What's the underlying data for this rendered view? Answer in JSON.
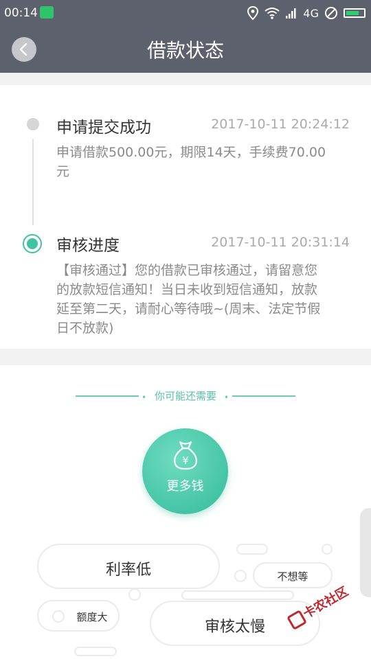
{
  "status_bar": {
    "time": "00:14",
    "network": "4G"
  },
  "header": {
    "title": "借款状态"
  },
  "timeline": [
    {
      "title": "申请提交成功",
      "time": "2017-10-11 20:24:12",
      "desc_line1": "申请借款500.00元，期限14天，手续费70.00",
      "desc_line2": "元"
    },
    {
      "title": "审核进度",
      "time": "2017-10-11 20:31:14",
      "desc_line1": "【审核通过】您的借款已审核通过，请留意您",
      "desc_line2": "的放款短信通知！当日未收到短信通知，放款",
      "desc_line3": "延至第二天，请耐心等待哦~(周末、法定节假",
      "desc_line4": "日不放款)"
    }
  ],
  "need": {
    "label": "你可能还需要",
    "more_money": "更多钱"
  },
  "tags": {
    "low_rate": "利率低",
    "no_wait": "不想等",
    "big_amount": "额度大",
    "slow_review": "审核太慢"
  },
  "watermark": "卡农社区",
  "colors": {
    "header_bg": "#5d606d",
    "accent": "#3ec4a2",
    "watermark": "#c0282d"
  },
  "icons": [
    "wechat-icon",
    "location-icon",
    "wifi-icon",
    "signal-icon",
    "no-sim-icon",
    "battery-icon",
    "back-arrow-icon",
    "money-bag-icon"
  ]
}
